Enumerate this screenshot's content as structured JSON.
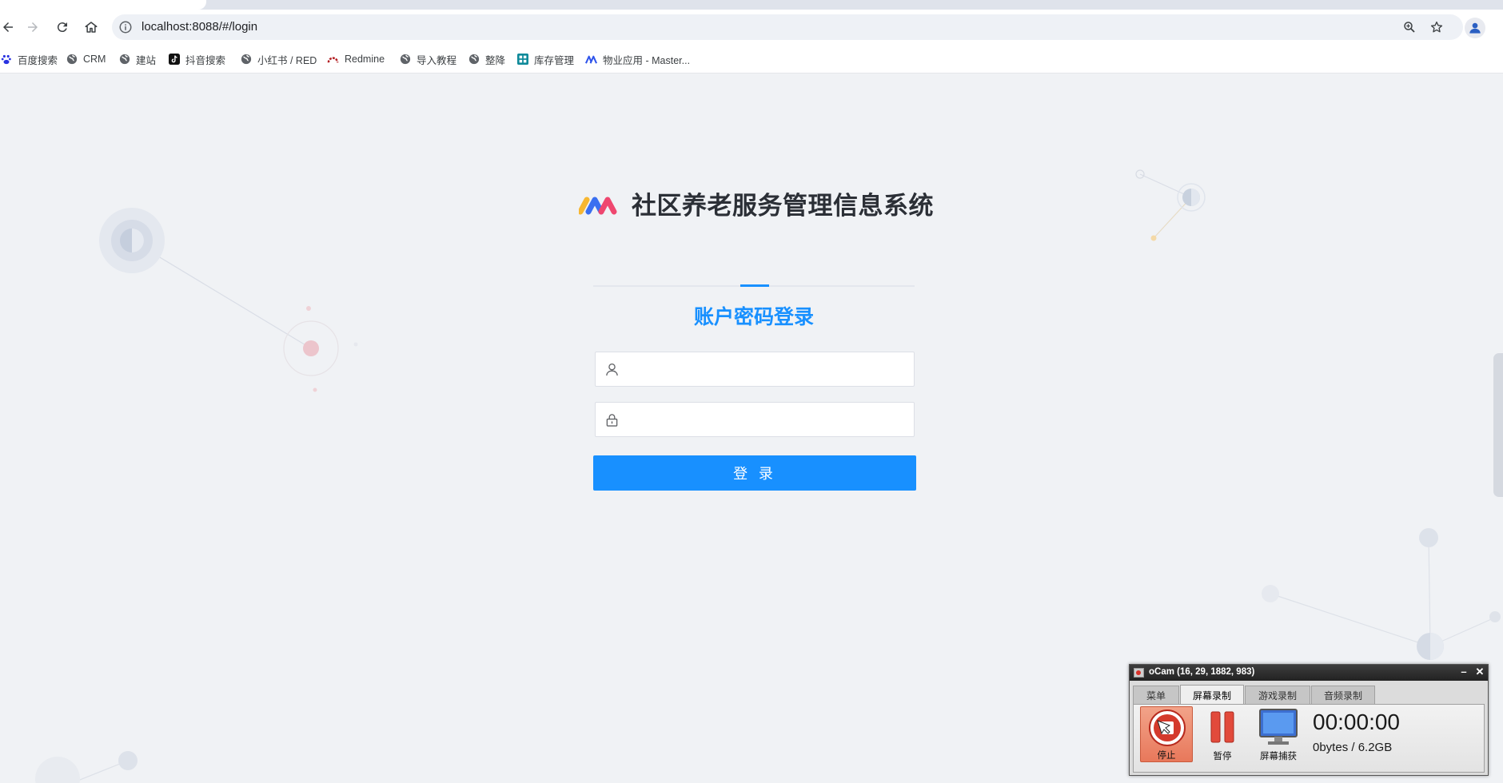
{
  "browser": {
    "url": "localhost:8088/#/login",
    "bookmarks": [
      {
        "label": "百度搜索",
        "icon": "baidu-icon"
      },
      {
        "label": "CRM",
        "icon": "globe-icon"
      },
      {
        "label": "建站",
        "icon": "globe-icon"
      },
      {
        "label": "抖音搜索",
        "icon": "tiktok-icon"
      },
      {
        "label": "小红书 / RED",
        "icon": "globe-icon"
      },
      {
        "label": "Redmine",
        "icon": "redmine-icon"
      },
      {
        "label": "导入教程",
        "icon": "globe-icon"
      },
      {
        "label": "整降",
        "icon": "globe-icon"
      },
      {
        "label": "库存管理",
        "icon": "grid-app-icon"
      },
      {
        "label": "物业应用 - Master...",
        "icon": "master-icon"
      }
    ]
  },
  "login": {
    "system_title": "社区养老服务管理信息系统",
    "tab_label": "账户密码登录",
    "username": {
      "value": "",
      "placeholder": ""
    },
    "password": {
      "value": "",
      "placeholder": ""
    },
    "submit_label": "登 录"
  },
  "ocam": {
    "title": "oCam (16, 29, 1882, 983)",
    "tabs": [
      "菜单",
      "屏幕录制",
      "游戏录制",
      "音频录制"
    ],
    "active_tab": "屏幕录制",
    "buttons": {
      "stop": "停止",
      "pause": "暂停",
      "capture": "屏幕捕获"
    },
    "timer": "00:00:00",
    "storage": "0bytes / 6.2GB"
  },
  "colors": {
    "primary": "#1890ff",
    "page_background": "#f0f2f5",
    "title_text": "#2b2f36"
  }
}
